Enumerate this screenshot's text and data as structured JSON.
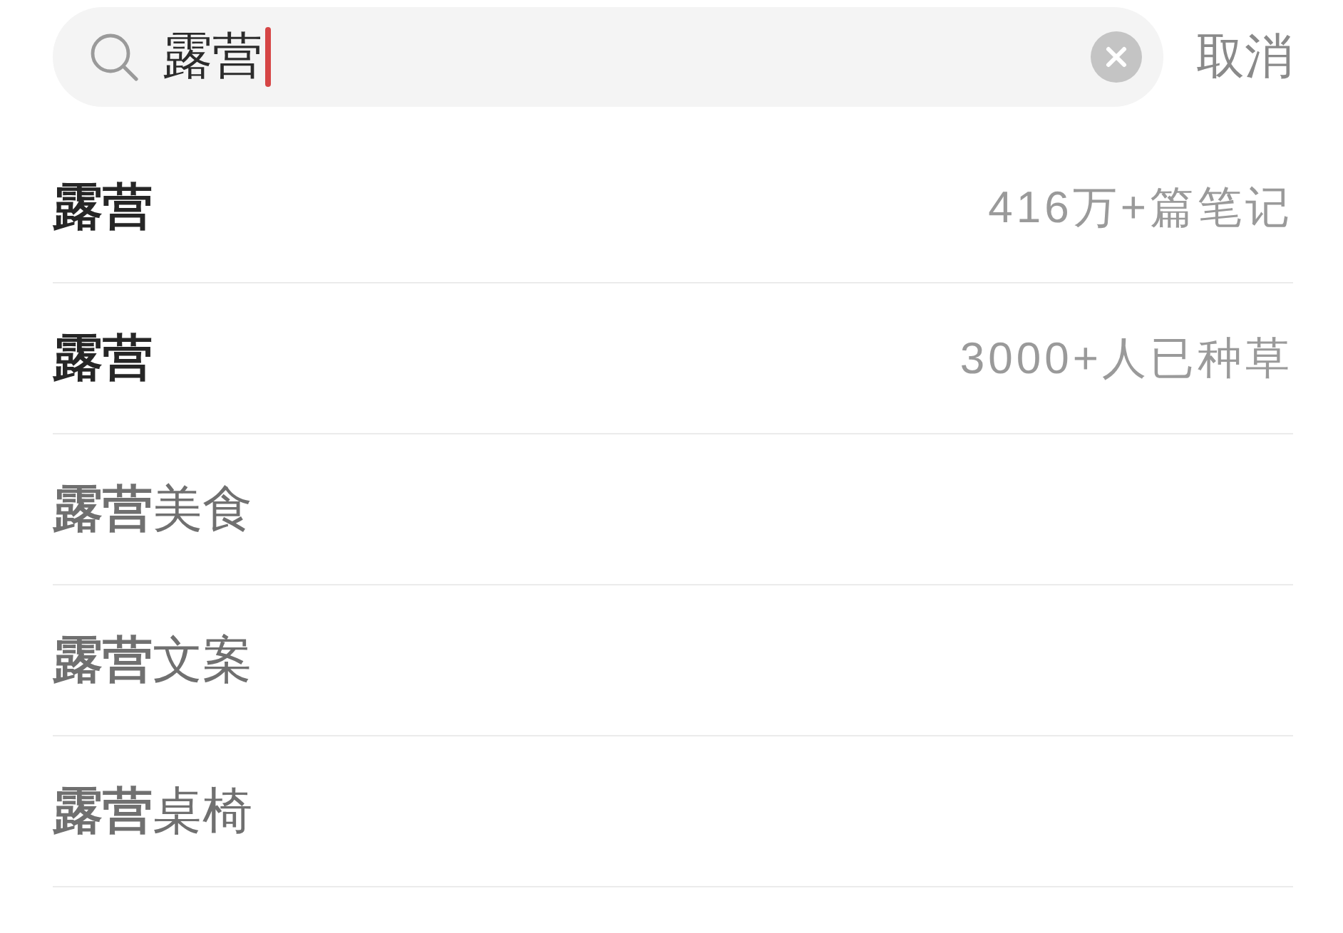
{
  "search": {
    "query": "露营",
    "focused": true,
    "cancel": "取消"
  },
  "suggestions": [
    {
      "kind": "exact",
      "text": "露营",
      "stat": "416万+篇笔记"
    },
    {
      "kind": "exact",
      "text": "露营",
      "stat": "3000+人已种草"
    },
    {
      "kind": "completion",
      "text": "**露营**美食"
    },
    {
      "kind": "completion",
      "text": "**露营**文案"
    },
    {
      "kind": "completion",
      "text": "**露营**桌椅"
    }
  ]
}
